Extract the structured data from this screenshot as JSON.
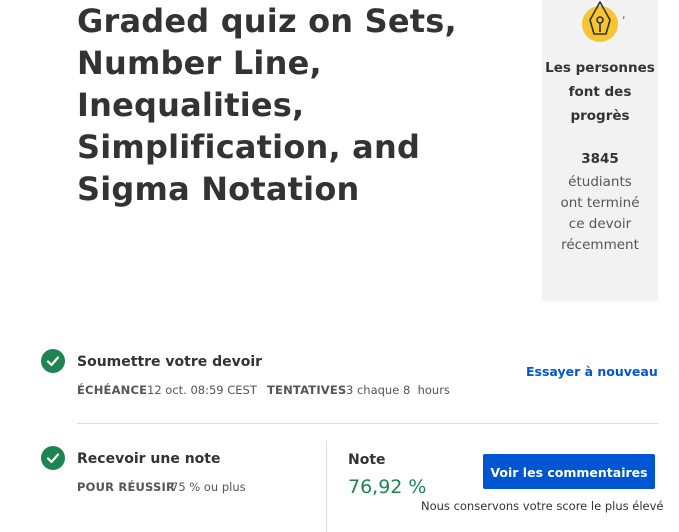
{
  "header": {
    "title": "Graded quiz on Sets, Number Line, Inequalities, Simplification, and Sigma Notation"
  },
  "progress_card": {
    "icon": "pen-nib-badge-icon",
    "icon_colors": {
      "badge": "#f7c531",
      "outline": "#333333"
    },
    "comma": ",",
    "headline": "Les personnes font des progrès",
    "count": "3845",
    "text": "étudiants ont terminé ce devoir récemment"
  },
  "submit": {
    "title": "Soumettre votre devoir",
    "due_label": "ÉCHÉANCE",
    "due_value": "12 oct. 08:59 CEST",
    "attempts_label": "TENTATIVES",
    "attempts_value": "3 chaque 8  hours",
    "retry_label": "Essayer à nouveau",
    "status_icon": "check-circle-icon"
  },
  "grade": {
    "title": "Recevoir une note",
    "pass_label": "POUR RÉUSSIR",
    "pass_value": "75 % ou plus",
    "note_label": "Note",
    "note_value": "76,92 %",
    "feedback_button": "Voir les commentaires",
    "keep_note": "Nous conservons votre score le plus élevé",
    "status_icon": "check-circle-icon"
  },
  "colors": {
    "success": "#1f8354",
    "primary": "#0056d2",
    "card_bg": "#f2f2f2"
  }
}
